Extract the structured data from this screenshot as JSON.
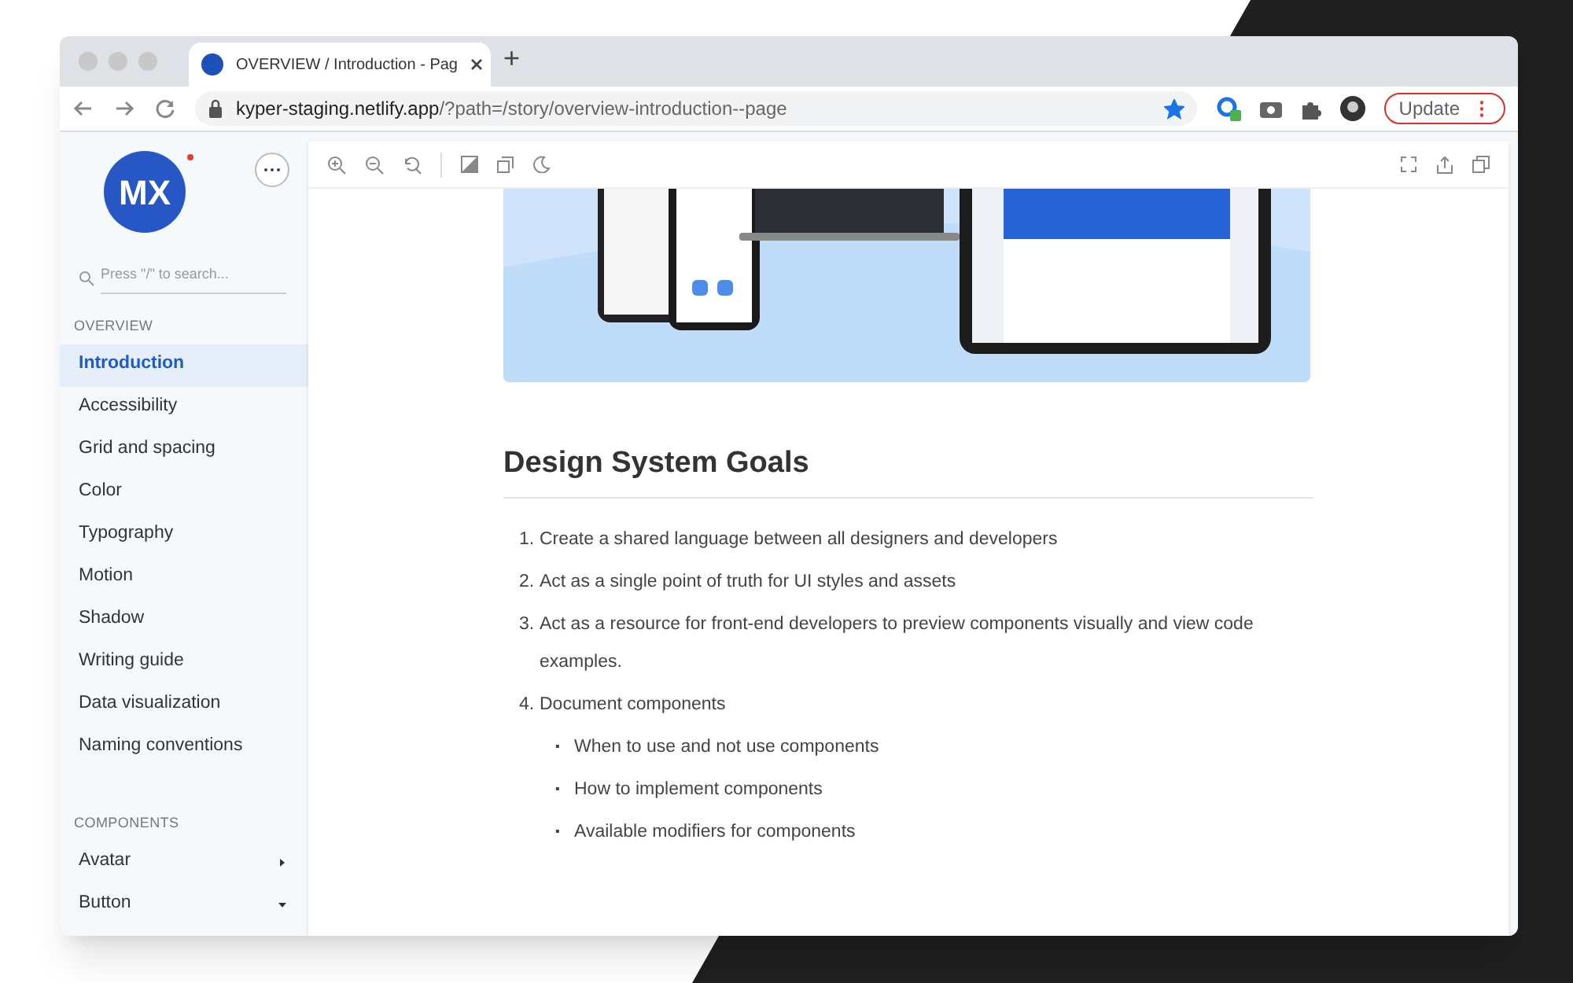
{
  "browser": {
    "tab_title": "OVERVIEW / Introduction - Pag",
    "new_tab": "+",
    "url_host": "kyper-staging.netlify.app",
    "url_path": "/?path=/story/overview-introduction--page",
    "bookmarked": true,
    "update_label": "Update",
    "update_menu": "⋮"
  },
  "sidebar": {
    "logo_text": "MX",
    "search_placeholder": "Press \"/\" to search...",
    "sections": [
      {
        "title": "OVERVIEW",
        "items": [
          {
            "label": "Introduction",
            "selected": true
          },
          {
            "label": "Accessibility",
            "selected": false
          },
          {
            "label": "Grid and spacing",
            "selected": false
          },
          {
            "label": "Color",
            "selected": false
          },
          {
            "label": "Typography",
            "selected": false
          },
          {
            "label": "Motion",
            "selected": false
          },
          {
            "label": "Shadow",
            "selected": false
          },
          {
            "label": "Writing guide",
            "selected": false
          },
          {
            "label": "Data visualization",
            "selected": false
          },
          {
            "label": "Naming conventions",
            "selected": false
          }
        ]
      },
      {
        "title": "COMPONENTS",
        "items": [
          {
            "label": "Avatar",
            "selected": false,
            "expanded": false
          },
          {
            "label": "Button",
            "selected": false,
            "expanded": true
          }
        ]
      }
    ]
  },
  "content": {
    "heading": "Design System Goals",
    "goals": [
      {
        "number": "1.",
        "text": "Create a shared language between all designers and developers"
      },
      {
        "number": "2.",
        "text": "Act as a single point of truth for UI styles and assets"
      },
      {
        "number": "3.",
        "text": "Act as a resource for front-end developers to preview components visually and view code examples."
      },
      {
        "number": "4.",
        "text": "Document components",
        "children": [
          {
            "bullet": "▪",
            "text": "When to use and not use components"
          },
          {
            "bullet": "▪",
            "text": "How to implement components"
          },
          {
            "bullet": "▪",
            "text": "Available modifiers for components"
          }
        ]
      }
    ]
  }
}
